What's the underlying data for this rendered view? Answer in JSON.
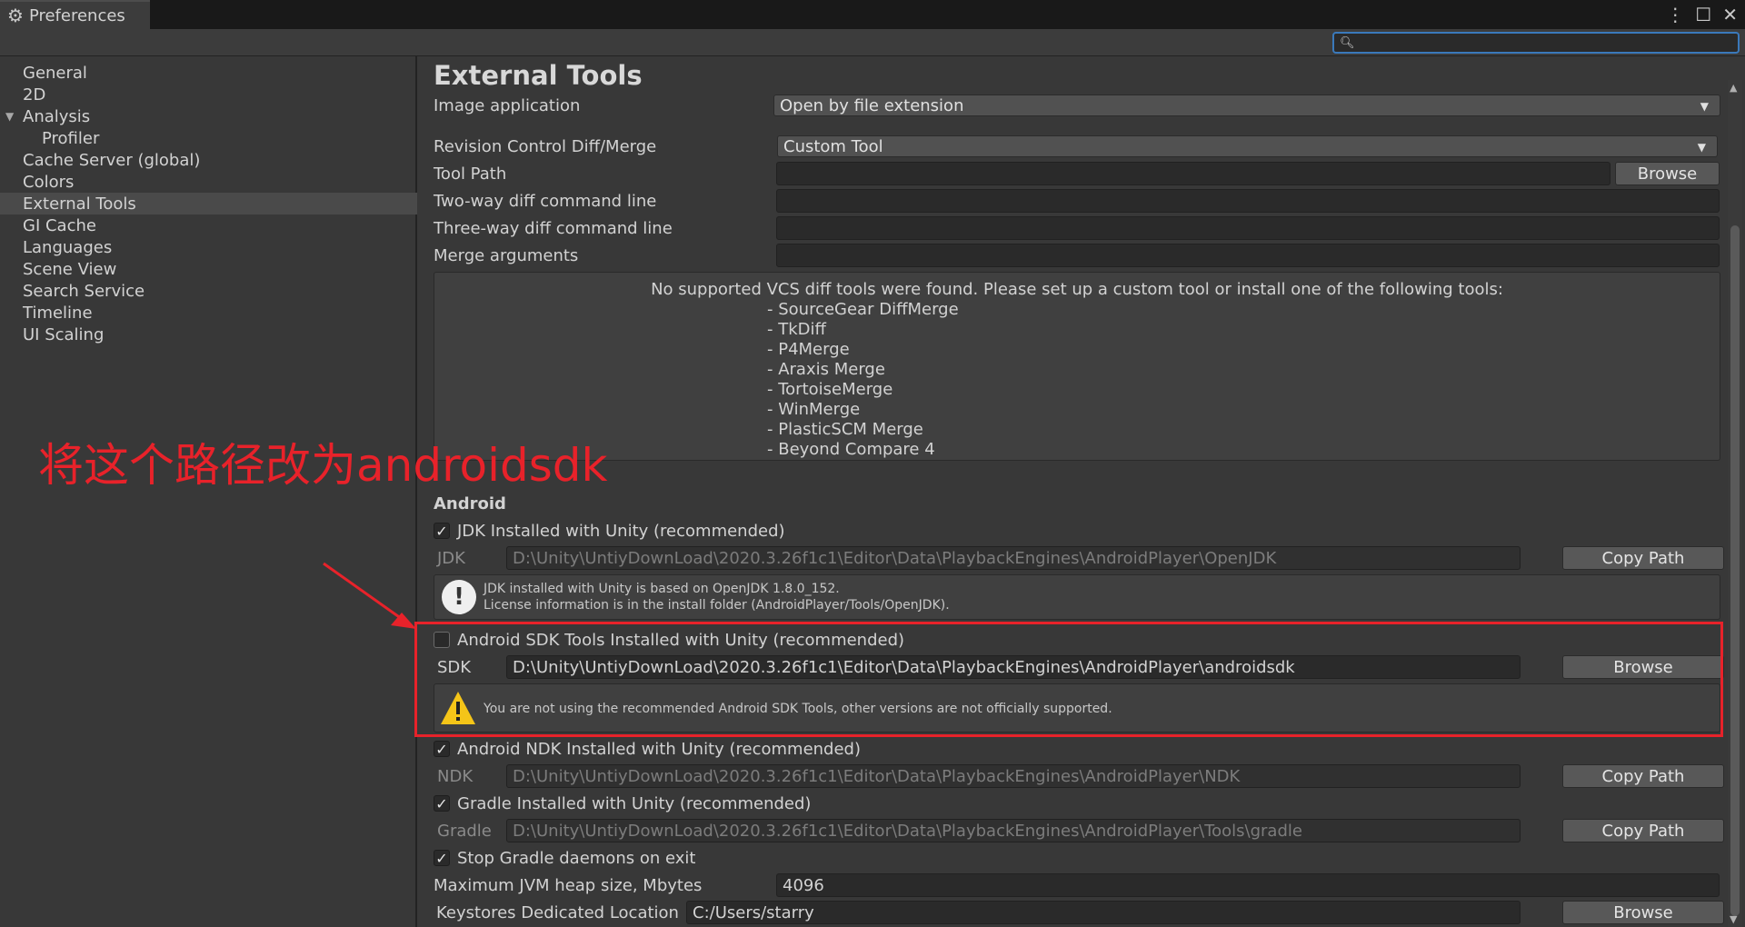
{
  "window": {
    "tab_label": "Preferences",
    "search_placeholder": ""
  },
  "sidebar": {
    "items": [
      {
        "label": "General"
      },
      {
        "label": "2D"
      },
      {
        "label": "Analysis"
      },
      {
        "label": "Profiler"
      },
      {
        "label": "Cache Server (global)"
      },
      {
        "label": "Colors"
      },
      {
        "label": "External Tools"
      },
      {
        "label": "GI Cache"
      },
      {
        "label": "Languages"
      },
      {
        "label": "Scene View"
      },
      {
        "label": "Search Service"
      },
      {
        "label": "Timeline"
      },
      {
        "label": "UI Scaling"
      }
    ],
    "selected": "External Tools"
  },
  "content": {
    "title": "External Tools",
    "image_application": {
      "label": "Image application",
      "value": "Open by file extension"
    },
    "revision_control": {
      "label": "Revision Control Diff/Merge",
      "value": "Custom Tool"
    },
    "tool_path": {
      "label": "Tool Path",
      "value": "",
      "button": "Browse"
    },
    "two_way": {
      "label": "Two-way diff command line",
      "value": ""
    },
    "three_way": {
      "label": "Three-way diff command line",
      "value": ""
    },
    "merge_args": {
      "label": "Merge arguments",
      "value": ""
    },
    "vcs_help": {
      "title": "No supported VCS diff tools were found. Please set up a custom tool or install one of the following tools:",
      "tools": [
        "- SourceGear DiffMerge",
        "- TkDiff",
        "- P4Merge",
        "- Araxis Merge",
        "- TortoiseMerge",
        "- WinMerge",
        "- PlasticSCM Merge",
        "- Beyond Compare 4"
      ]
    },
    "android": {
      "section": "Android",
      "jdk_check": {
        "label": "JDK Installed with Unity (recommended)",
        "checked": true
      },
      "jdk": {
        "label": "JDK",
        "value": "D:\\Unity\\UntiyDownLoad\\2020.3.26f1c1\\Editor\\Data\\PlaybackEngines\\AndroidPlayer\\OpenJDK",
        "button": "Copy Path"
      },
      "jdk_info": {
        "line1": "JDK installed with Unity is based on OpenJDK 1.8.0_152.",
        "line2": "License information is in the install folder (AndroidPlayer/Tools/OpenJDK)."
      },
      "sdk_check": {
        "label": "Android SDK Tools Installed with Unity (recommended)",
        "checked": false
      },
      "sdk": {
        "label": "SDK",
        "value": "D:\\Unity\\UntiyDownLoad\\2020.3.26f1c1\\Editor\\Data\\PlaybackEngines\\AndroidPlayer\\androidsdk",
        "button": "Browse"
      },
      "sdk_warning": "You are not using the recommended Android SDK Tools, other versions are not officially supported.",
      "ndk_check": {
        "label": "Android NDK Installed with Unity (recommended)",
        "checked": true
      },
      "ndk": {
        "label": "NDK",
        "value": "D:\\Unity\\UntiyDownLoad\\2020.3.26f1c1\\Editor\\Data\\PlaybackEngines\\AndroidPlayer\\NDK",
        "button": "Copy Path"
      },
      "gradle_check": {
        "label": "Gradle Installed with Unity (recommended)",
        "checked": true
      },
      "gradle": {
        "label": "Gradle",
        "value": "D:\\Unity\\UntiyDownLoad\\2020.3.26f1c1\\Editor\\Data\\PlaybackEngines\\AndroidPlayer\\Tools\\gradle",
        "button": "Copy Path"
      },
      "stop_gradle": {
        "label": "Stop Gradle daemons on exit",
        "checked": true
      },
      "jvm_heap": {
        "label": "Maximum JVM heap size, Mbytes",
        "value": "4096"
      },
      "keystores": {
        "label": "Keystores Dedicated Location",
        "value": "C:/Users/starry",
        "button": "Browse"
      }
    }
  },
  "annotation": {
    "text": "将这个路径改为androidsdk",
    "color": "#e8222a"
  }
}
